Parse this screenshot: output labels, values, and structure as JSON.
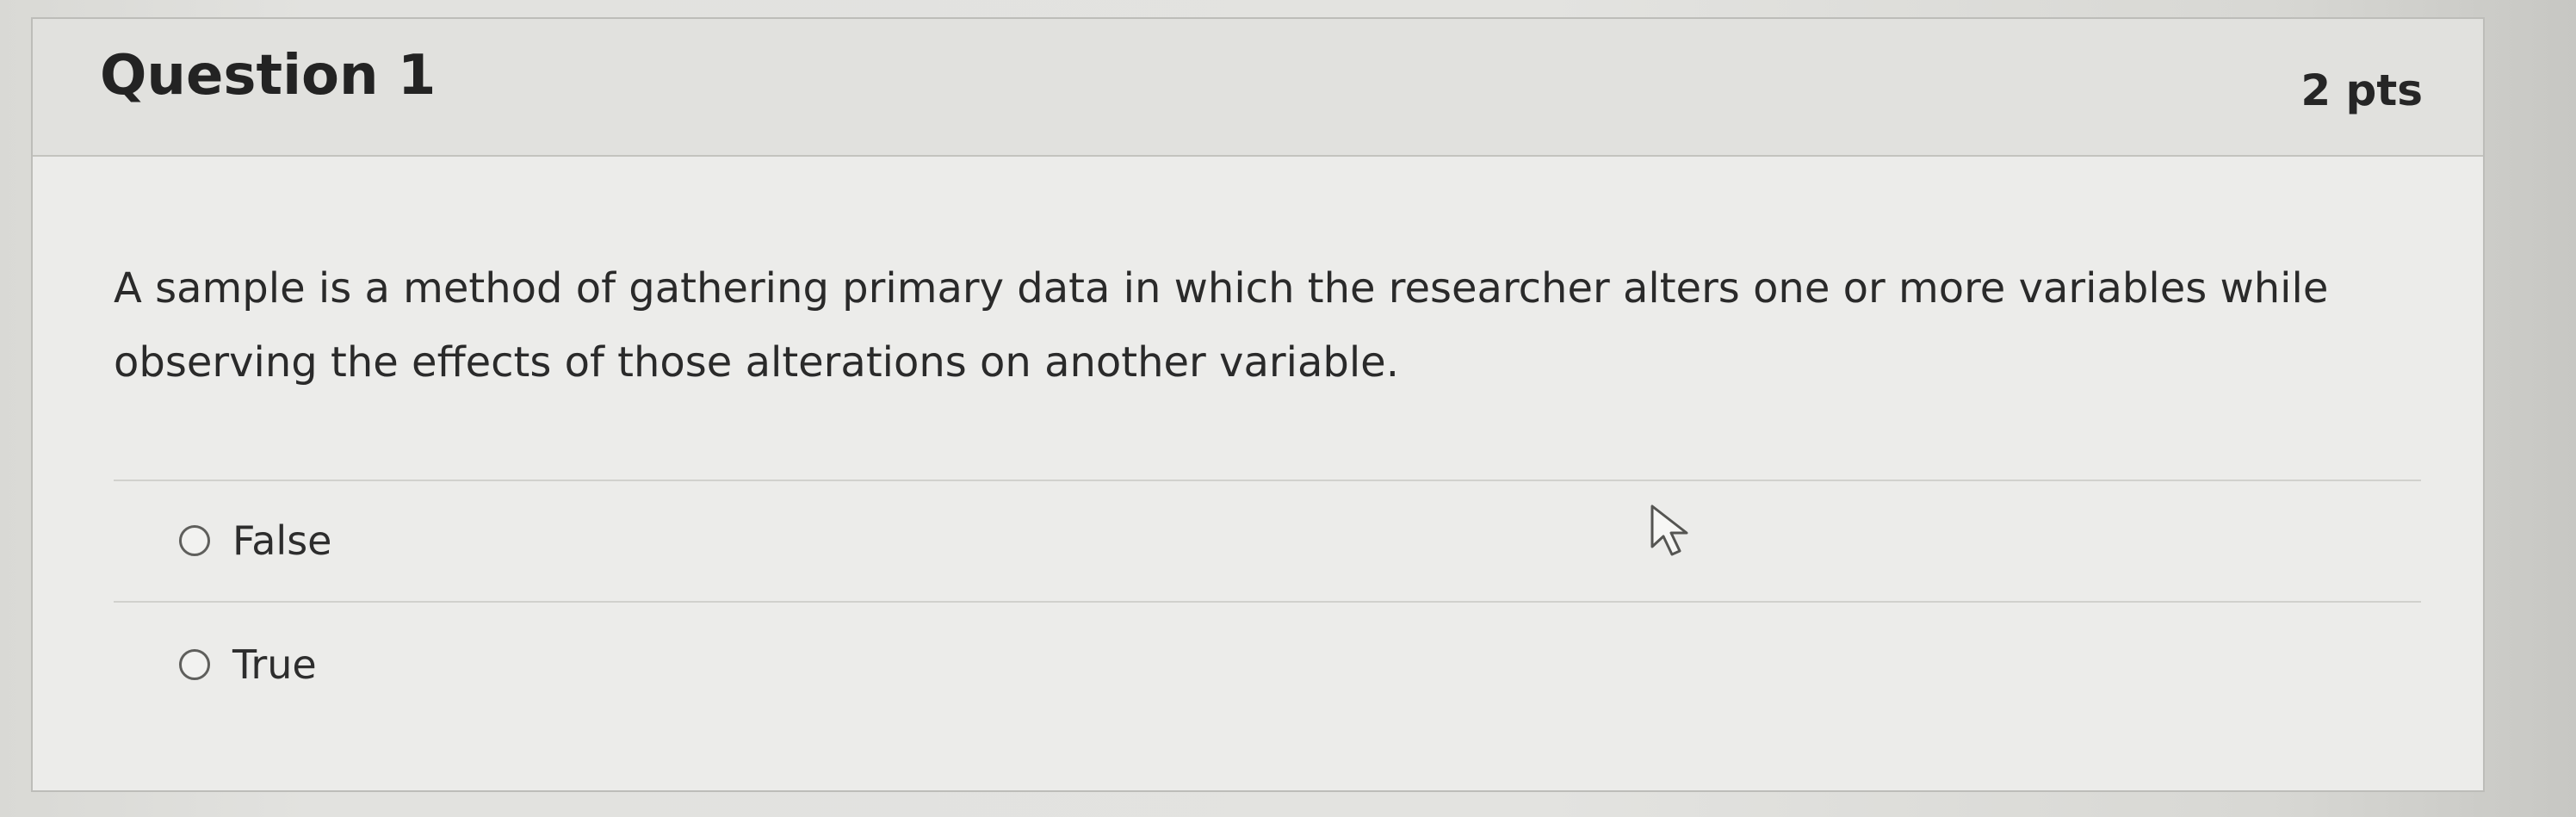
{
  "question": {
    "title": "Question 1",
    "points": "2 pts",
    "body_line_1": "A sample is a method of gathering primary data in which the researcher alters one or more variables while",
    "body_line_2": "observing the effects of those alterations on another variable."
  },
  "answers": [
    {
      "label": "False"
    },
    {
      "label": "True"
    }
  ],
  "icons": {
    "radio": "radio-button-icon",
    "cursor": "mouse-pointer-icon"
  },
  "colors": {
    "header_background": "#e1e1de",
    "card_background": "#ececea",
    "text": "#2b2b2b",
    "radio_border": "#5f5f5c"
  }
}
